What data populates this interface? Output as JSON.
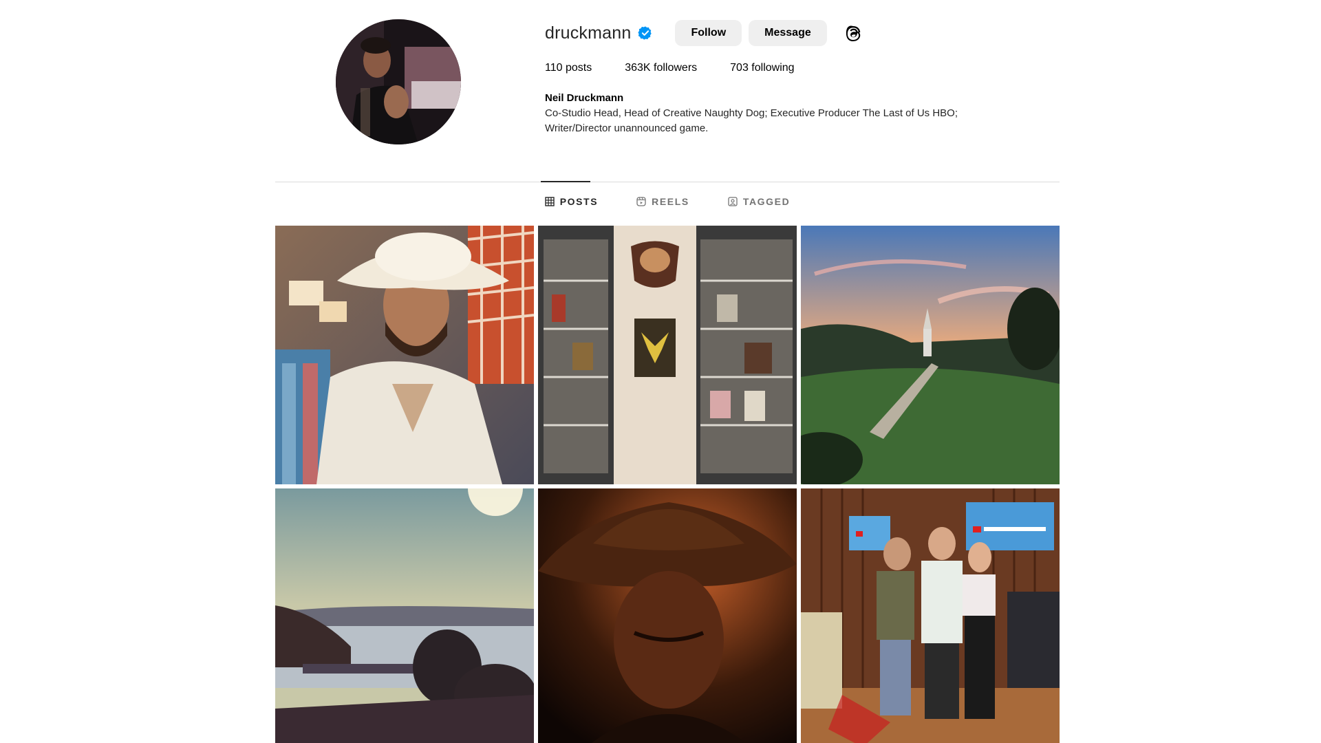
{
  "profile": {
    "username": "druckmann",
    "verified_icon": "verified-badge-icon",
    "follow_label": "Follow",
    "message_label": "Message",
    "threads_icon": "threads-icon",
    "full_name": "Neil Druckmann",
    "bio": "Co-Studio Head, Head of Creative Naughty Dog; Executive Producer The Last of Us HBO; Writer/Director unannounced game."
  },
  "stats": {
    "posts": "110 posts",
    "followers": "363K followers",
    "following": "703 following"
  },
  "tabs": [
    {
      "label": "POSTS",
      "icon": "grid-icon",
      "active": true
    },
    {
      "label": "REELS",
      "icon": "reels-icon",
      "active": false
    },
    {
      "label": "TAGGED",
      "icon": "tagged-icon",
      "active": false
    }
  ],
  "posts": [
    {
      "subject": "man in cowboy hat in clothing store"
    },
    {
      "subject": "display shelves with collectibles and firefly poster"
    },
    {
      "subject": "sunset over valley with chapel"
    },
    {
      "subject": "lake at sunset with trees"
    },
    {
      "subject": "man in fedora hat in dark light"
    },
    {
      "subject": "three people posing at YouTube Theater"
    }
  ],
  "colors": {
    "verified": "#0095f6",
    "button_bg": "#efefef",
    "divider": "#dbdbdb"
  }
}
